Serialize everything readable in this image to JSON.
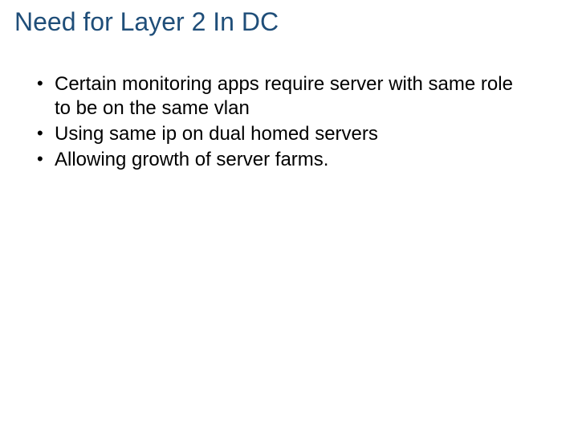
{
  "slide": {
    "title": "Need for Layer 2 In DC",
    "bullets": [
      "Certain monitoring apps require server with same role to be on the same vlan",
      "Using same ip on dual homed servers",
      "Allowing growth of server farms."
    ]
  }
}
